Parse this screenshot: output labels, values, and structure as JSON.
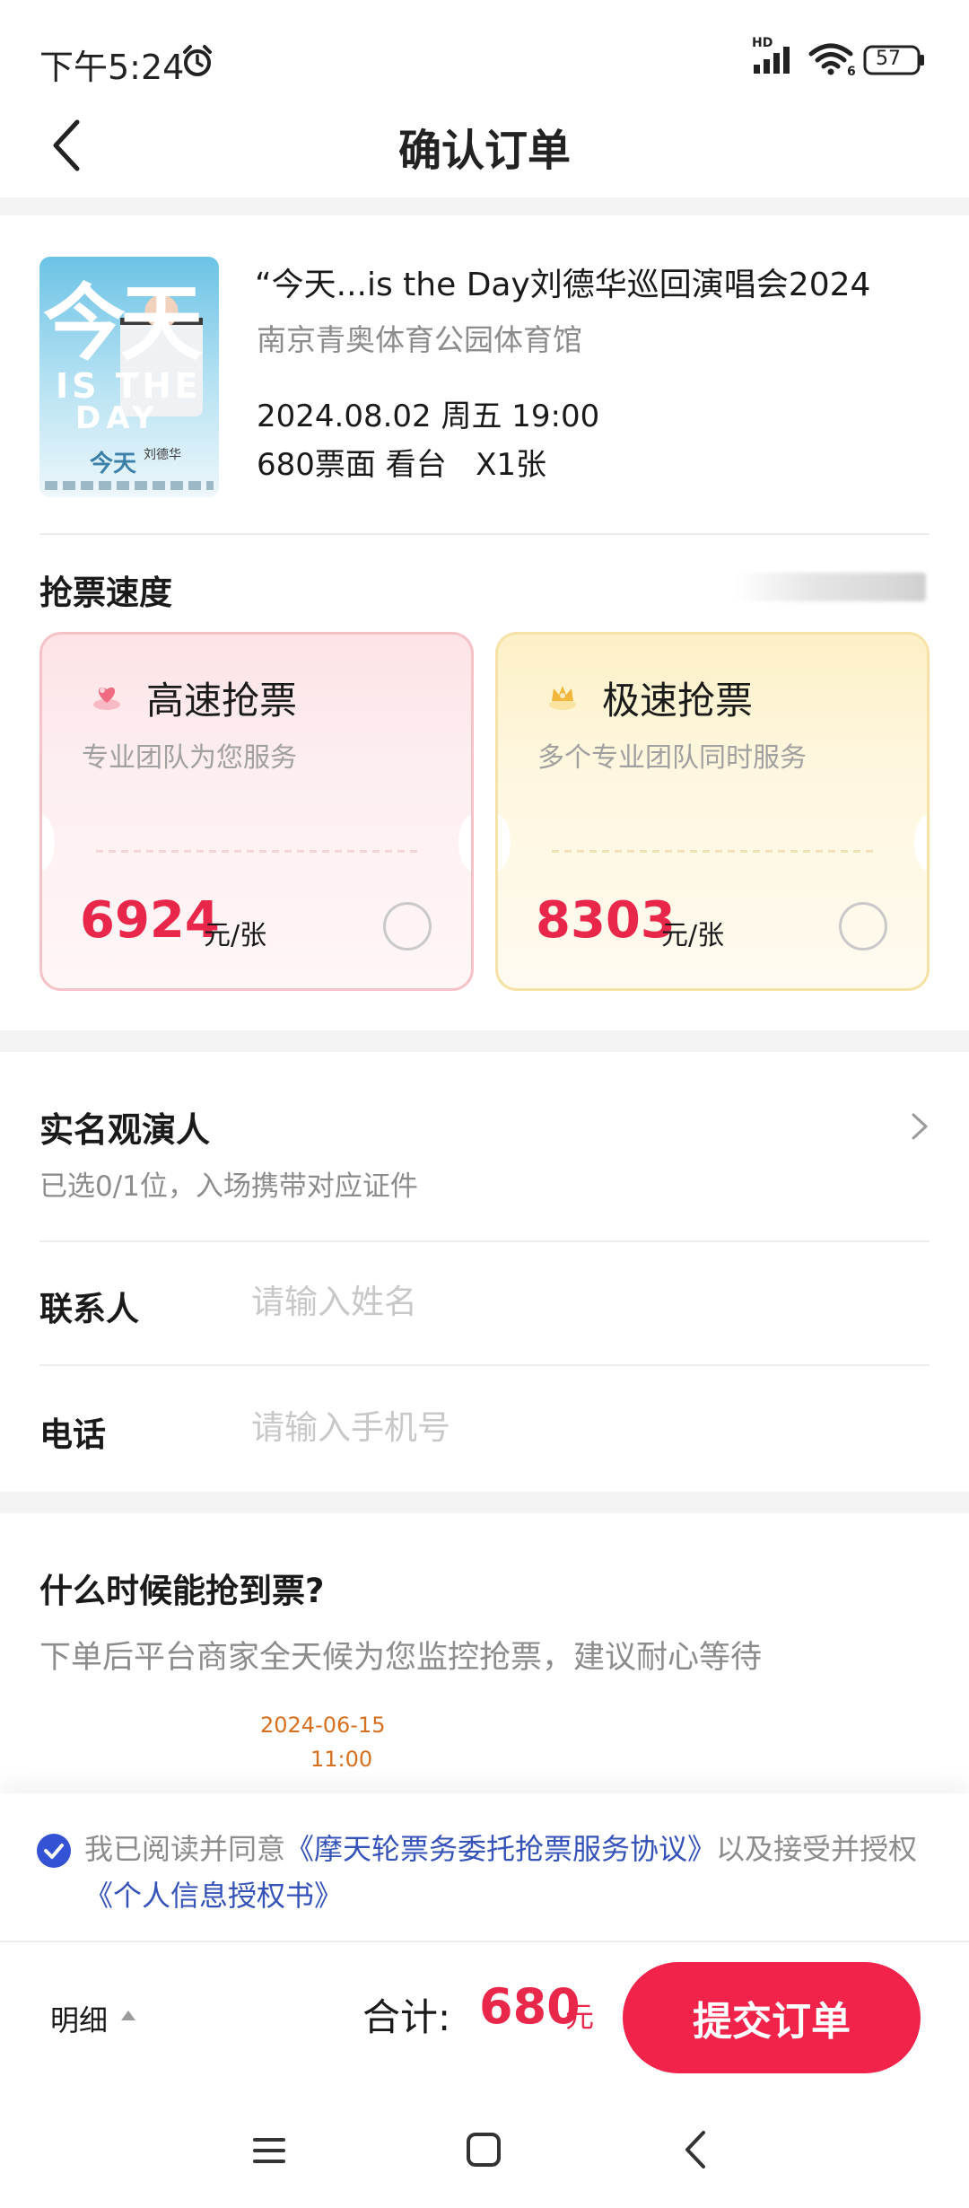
{
  "status_bar": {
    "time": "下午5:24",
    "hd": "HD",
    "battery": "57",
    "icons": [
      "alarm-icon",
      "signal-icon",
      "wifi-icon",
      "battery-icon"
    ]
  },
  "header": {
    "title": "确认订单",
    "back_icon": "back-arrow-icon"
  },
  "event": {
    "poster": {
      "big_text": "今天",
      "line1": "IS THE",
      "line2": "DAY",
      "small_text": "今天",
      "artist": "刘德华"
    },
    "title": "“今天...is the Day刘德华巡回演唱会2024",
    "venue": "南京青奥体育公园体育馆",
    "datetime": "2024.08.02 周五 19:00",
    "ticket": "680票面 看台   X1张"
  },
  "speed": {
    "title": "抢票速度",
    "options": [
      {
        "name": "高速抢票",
        "desc": "专业团队为您服务",
        "price": "6924",
        "unit": "元/张",
        "selected": false,
        "icon": "heart-gem-icon",
        "accent": "#e8274b"
      },
      {
        "name": "极速抢票",
        "desc": "多个专业团队同时服务",
        "price": "8303",
        "unit": "元/张",
        "selected": false,
        "icon": "crown-gem-icon",
        "accent": "#f0c24a"
      }
    ]
  },
  "attendee": {
    "title": "实名观演人",
    "subtitle": "已选0/1位，入场携带对应证件"
  },
  "contact": {
    "label": "联系人",
    "placeholder": "请输入姓名",
    "value": ""
  },
  "phone": {
    "label": "电话",
    "placeholder": "请输入手机号",
    "value": ""
  },
  "info": {
    "title": "什么时候能抢到票?",
    "desc": "下单后平台商家全天候为您监控抢票，建议耐心等待",
    "time_date": "2024-06-15",
    "time_clock": "11:00"
  },
  "agreement": {
    "checked": true,
    "text1": "我已阅读并同意",
    "link1": "《摩天轮票务委托抢票服务协议》",
    "text2": "以及接受并授权",
    "link2": "《个人信息授权书》"
  },
  "bottom": {
    "detail_label": "明细",
    "total_label": "合计:",
    "total_amount": "680",
    "total_unit": "元",
    "submit_label": "提交订单",
    "brand_color": "#f2234a"
  },
  "nav": {
    "icons": [
      "menu-icon",
      "home-icon",
      "back-icon"
    ]
  }
}
